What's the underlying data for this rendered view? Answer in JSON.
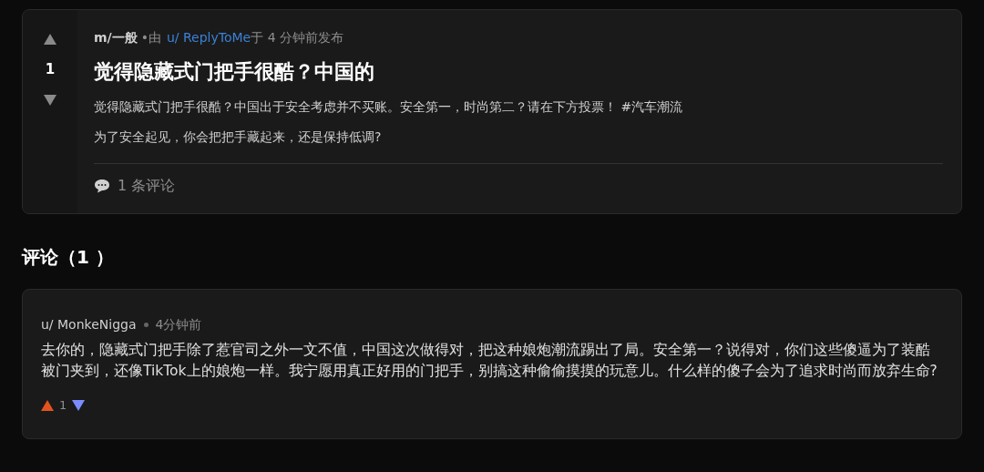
{
  "post": {
    "score": "1",
    "upvoted": false,
    "downvoted": false,
    "community": "m/一般",
    "by": "•由",
    "author": "u/ ReplyToMe",
    "time": "于 4 分钟前发布",
    "title": "觉得隐藏式门把手很酷？中国的",
    "body": [
      "觉得隐藏式门把手很酷？中国出于安全考虑并不买账。安全第一，时尚第二？请在下方投票！ #汽车潮流",
      "为了安全起见，你会把把手藏起来，还是保持低调?"
    ],
    "comments_link": "1 条评论"
  },
  "comments_heading": "评论（1 ）",
  "comments": [
    {
      "author": "u/ MonkeNigga",
      "time": "4分钟前",
      "text": "去你的，隐藏式门把手除了惹官司之外一文不值，中国这次做得对，把这种娘炮潮流踢出了局。安全第一？说得对，你们这些傻逼为了装酷被门夹到，还像TikTok上的娘炮一样。我宁愿用真正好用的门把手，别搞这种偷偷摸摸的玩意儿。什么样的傻子会为了追求时尚而放弃生命?",
      "score": "1",
      "upvoted": true,
      "downvoted": true
    }
  ]
}
